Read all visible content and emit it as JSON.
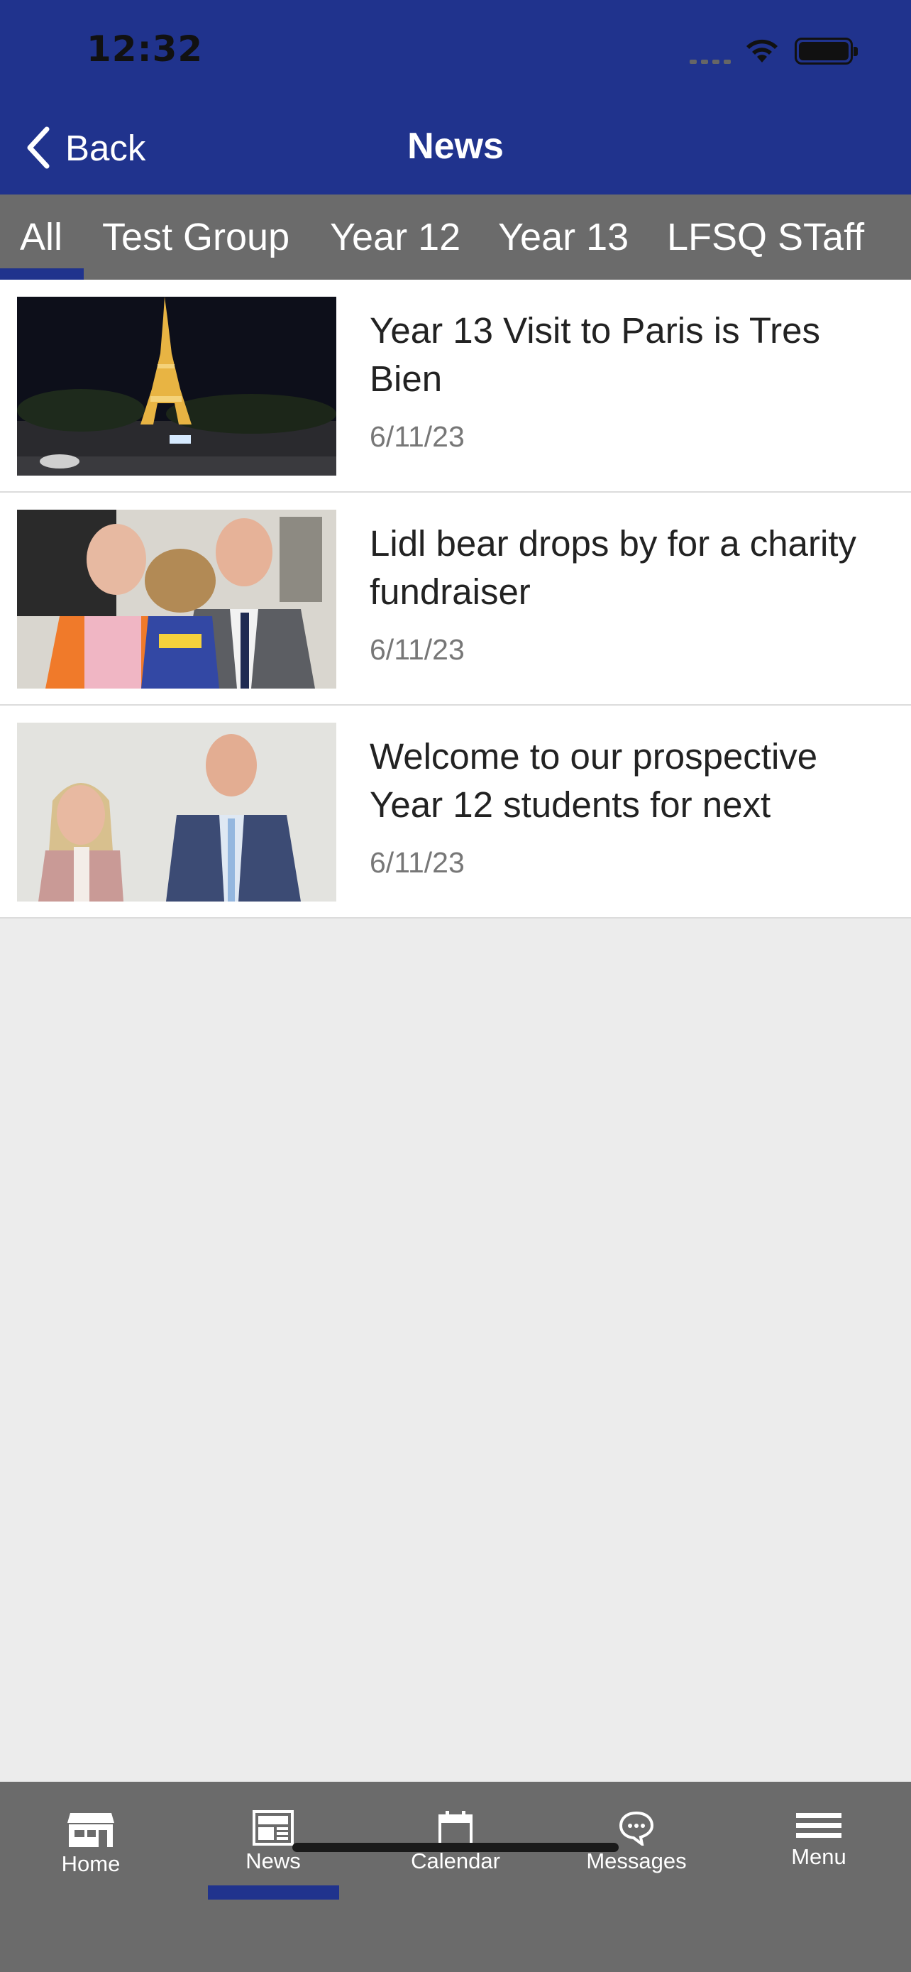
{
  "status_bar": {
    "time": "12:32"
  },
  "header": {
    "back_label": "Back",
    "title": "News"
  },
  "tabs": [
    {
      "label": "All",
      "active": true
    },
    {
      "label": "Test Group",
      "active": false
    },
    {
      "label": "Year 12",
      "active": false
    },
    {
      "label": "Year 13",
      "active": false
    },
    {
      "label": "LFSQ STaff",
      "active": false
    }
  ],
  "news": [
    {
      "title": "Year 13 Visit to Paris is Tres Bien",
      "date": "6/11/23",
      "image": "eiffel-tower-night-photo"
    },
    {
      "title": "Lidl bear drops by for a charity fundraiser",
      "date": "6/11/23",
      "image": "lidl-bear-photo"
    },
    {
      "title": "Welcome to our prospective Year 12 students for next",
      "date": "6/11/23",
      "image": "staff-welcome-photo"
    }
  ],
  "tabbar": {
    "items": [
      {
        "label": "Home",
        "icon": "home-icon"
      },
      {
        "label": "News",
        "icon": "news-icon",
        "active": true
      },
      {
        "label": "Calendar",
        "icon": "calendar-icon"
      },
      {
        "label": "Messages",
        "icon": "messages-icon"
      },
      {
        "label": "Menu",
        "icon": "menu-icon"
      }
    ]
  },
  "colors": {
    "brand": "#20338d",
    "tab_bg": "#6b6b6b",
    "page_bg": "#ececec"
  }
}
